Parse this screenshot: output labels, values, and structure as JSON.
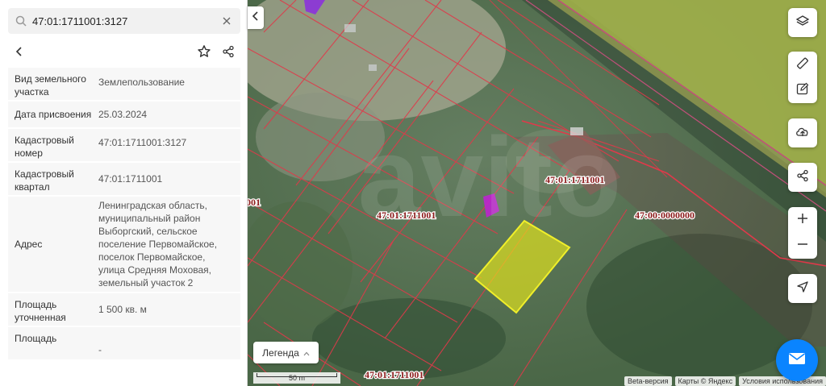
{
  "search": {
    "value": "47:01:1711001:3127"
  },
  "details": [
    {
      "label": "Вид земельного участка",
      "value": "Землепользование"
    },
    {
      "label": "Дата присвоения",
      "value": "25.03.2024"
    },
    {
      "label": "Кадастровый номер",
      "value": "47:01:1711001:3127"
    },
    {
      "label": "Кадастровый квартал",
      "value": "47:01:1711001"
    },
    {
      "label": "Адрес",
      "value": "Ленинградская область, муниципальный район Выборгский, сельское поселение Первомайское, поселок Первомайское, улица Средняя Моховая, земельный участок 2"
    },
    {
      "label": "Площадь уточненная",
      "value": "1 500 кв. м"
    },
    {
      "label": "Площадь",
      "value": "-"
    }
  ],
  "map": {
    "labels": {
      "quarter_left": "47:01:1711001",
      "quarter_right": "47:01:1711001",
      "quarter_bottom": "47:01:1711001",
      "quarter_edge": "001",
      "district": "47:00:0000000"
    },
    "legend_label": "Легенда",
    "scale_label": "50 m",
    "attribution": {
      "beta": "Beta-версия",
      "maps": "Карты © Яндекс",
      "terms": "Условия использования"
    },
    "colors": {
      "selected_parcel": "#e8e81a",
      "parcel_border": "#e0394a",
      "purple_parcel": "#c21ed6"
    }
  },
  "icons": {
    "search": "search-icon",
    "clear": "close-icon",
    "back": "chevron-left-icon",
    "favorite": "star-icon",
    "share": "share-icon",
    "layers": "layers-icon",
    "ruler": "ruler-icon",
    "edit": "edit-icon",
    "upload": "cloud-upload-icon",
    "map_share": "share-icon",
    "zoom_in": "plus-icon",
    "zoom_out": "minus-icon",
    "locate": "location-arrow-icon",
    "chat": "mail-icon"
  }
}
